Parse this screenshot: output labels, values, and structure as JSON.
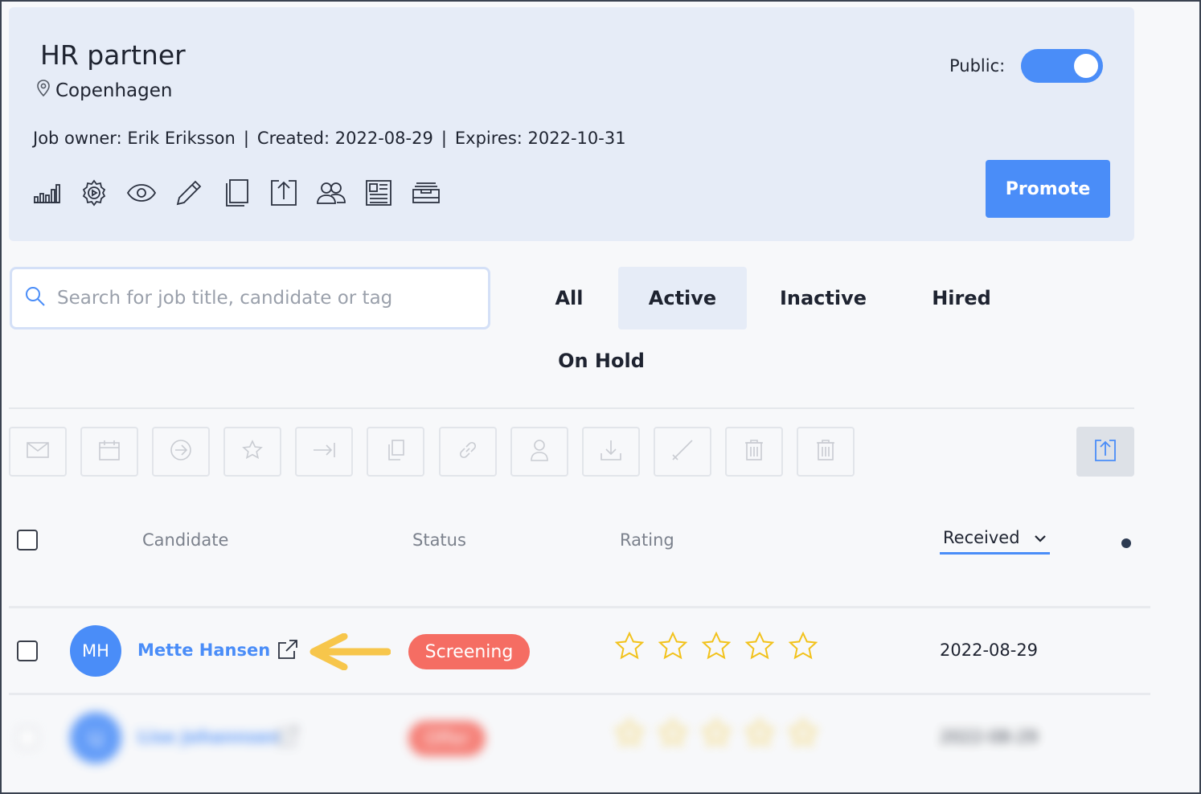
{
  "job": {
    "title": "HR partner",
    "location": "Copenhagen",
    "owner": "Job owner: Erik Eriksson",
    "created": "Created: 2022-08-29",
    "expires": "Expires: 2022-10-31",
    "public_label": "Public:",
    "public_on": true,
    "promote_label": "Promote",
    "tool_icons": [
      "stats-icon",
      "settings-icon",
      "preview-icon",
      "edit-icon",
      "copy-icon",
      "share-icon",
      "team-icon",
      "form-icon",
      "archive-icon"
    ]
  },
  "search": {
    "placeholder": "Search for job title, candidate or tag",
    "value": ""
  },
  "tabs": [
    {
      "label": "All",
      "active": false
    },
    {
      "label": "Active",
      "active": true
    },
    {
      "label": "Inactive",
      "active": false
    },
    {
      "label": "Hired",
      "active": false
    },
    {
      "label": "On Hold",
      "active": false
    }
  ],
  "actions": [
    "email-icon",
    "calendar-icon",
    "move-icon",
    "star-icon",
    "forward-icon",
    "copy-icon",
    "link-icon",
    "user-icon",
    "download-icon",
    "check-icon",
    "trash-icon",
    "trash-icon"
  ],
  "table": {
    "headers": {
      "candidate": "Candidate",
      "status": "Status",
      "rating": "Rating",
      "received": "Received"
    },
    "rows": [
      {
        "initials": "MH",
        "name": "Mette Hansen",
        "status": "Screening",
        "rating": 0,
        "received": "2022-08-29"
      },
      {
        "initials": "LJ",
        "name": "Lise Johannsen",
        "status": "Offer",
        "rating": 0,
        "received": "2022-08-29"
      }
    ]
  },
  "colors": {
    "accent": "#4a8df8",
    "status_screening": "#f56d63",
    "star": "#f2c21b",
    "arrow": "#f7c64b"
  }
}
